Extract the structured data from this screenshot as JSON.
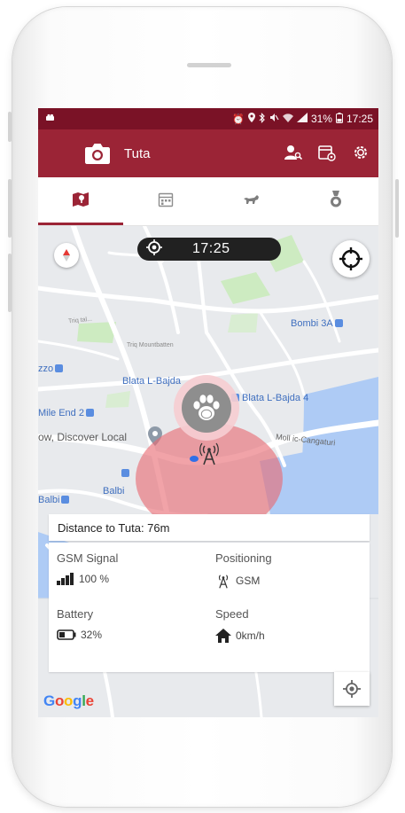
{
  "status_bar": {
    "battery": "31%",
    "time": "17:25",
    "indicators": [
      "alarm-icon",
      "location-icon",
      "bluetooth-icon",
      "mute-icon",
      "wifi-icon",
      "signal-icon",
      "battery-icon"
    ]
  },
  "app_bar": {
    "title": "Tuta",
    "actions": [
      "person-search-icon",
      "calendar-settings-icon",
      "gear-icon"
    ]
  },
  "tabs": [
    {
      "icon": "map-pin-icon",
      "active": true
    },
    {
      "icon": "calendar-icon",
      "active": false
    },
    {
      "icon": "walking-dog-icon",
      "active": false
    },
    {
      "icon": "medal-icon",
      "active": false
    }
  ],
  "map": {
    "time_display": "17:25",
    "labels": {
      "bombi": "Bombi 3A",
      "triq_tal": "Triq tal...",
      "triq_mount": "Triq Mountbatten",
      "zzo": "zzo",
      "blata": "Blata L-Bajda",
      "blata4": "Blata L-Bajda 4",
      "mile_end": "Mile End 2",
      "discover": "ow, Discover Local",
      "moll": "Moll ic-Cangaturi",
      "balbi1": "Balbi",
      "balbi2": "Balbi"
    }
  },
  "distance": {
    "text": "Distance to Tuta: 76m"
  },
  "info": {
    "gsm_label": "GSM Signal",
    "gsm_value": "100 %",
    "positioning_label": "Positioning",
    "positioning_value": "GSM",
    "battery_label": "Battery",
    "battery_value": "32%",
    "speed_label": "Speed",
    "speed_value": "0km/h"
  },
  "google": {
    "g1": "G",
    "o1": "o",
    "o2": "o",
    "g2": "g",
    "l": "l",
    "e": "e"
  },
  "colors": {
    "status_bar": "#7a1226",
    "app_bar": "#9b2436",
    "accuracy_circle": "#e86a72",
    "label_blue": "#3f6fbf"
  }
}
